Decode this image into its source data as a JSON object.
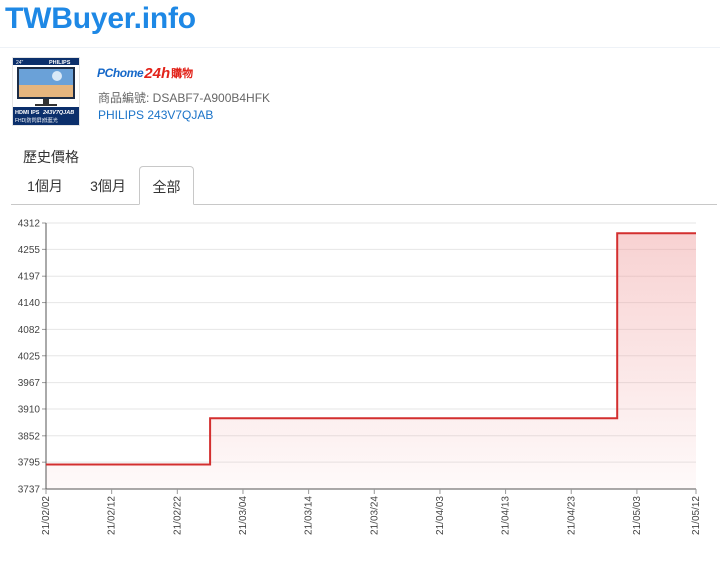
{
  "site": {
    "logo": "TWBuyer.info"
  },
  "product": {
    "thumbnail": {
      "brand": "PHILIPS",
      "size": "24\"",
      "badges": "HDMI IPS",
      "model": "243V7QJAB",
      "features": "FHD|防閃屏|低藍光"
    },
    "store": {
      "name_part1": "PChome",
      "name_part2": "24h",
      "name_part3": "購物"
    },
    "code_label": "商品編號: ",
    "code": "DSABF7-A900B4HFK",
    "link_text": "PHILIPS 243V7QJAB"
  },
  "history": {
    "title": "歷史價格",
    "tabs": [
      "1個月",
      "3個月",
      "全部"
    ],
    "active_tab": 2
  },
  "colors": {
    "brand": "#1e88e5",
    "line": "#d32f2f",
    "link": "#1a73c8"
  },
  "chart_data": {
    "type": "area",
    "step": true,
    "y_ticks": [
      3737,
      3795,
      3852,
      3910,
      3967,
      4025,
      4082,
      4140,
      4197,
      4255,
      4312
    ],
    "ylim": [
      3737,
      4312
    ],
    "x_ticks": [
      "21/02/02",
      "21/02/12",
      "21/02/22",
      "21/03/04",
      "21/03/14",
      "21/03/24",
      "21/04/03",
      "21/04/13",
      "21/04/23",
      "21/05/03",
      "21/05/12"
    ],
    "xlim": [
      "21/02/02",
      "21/05/12"
    ],
    "grid": true,
    "series": [
      {
        "points": [
          {
            "x": "21/02/02",
            "y": 3790
          },
          {
            "x": "21/02/27",
            "y": 3790
          },
          {
            "x": "21/02/27",
            "y": 3890
          },
          {
            "x": "21/04/30",
            "y": 3890
          },
          {
            "x": "21/04/30",
            "y": 4290
          },
          {
            "x": "21/05/12",
            "y": 4290
          }
        ]
      }
    ]
  }
}
